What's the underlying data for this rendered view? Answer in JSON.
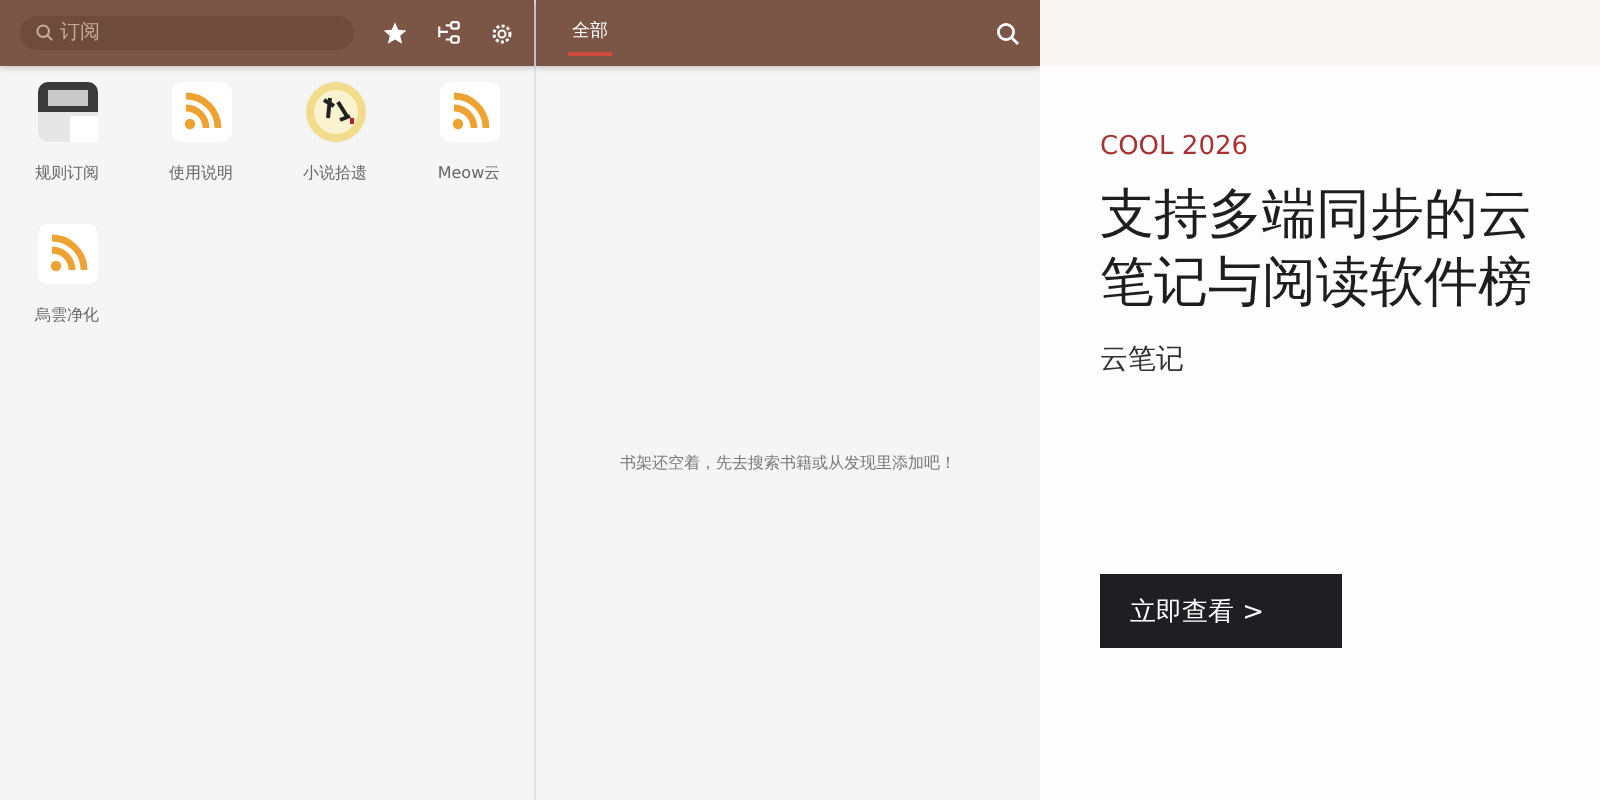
{
  "subscriptions": {
    "search": {
      "placeholder": "订阅"
    },
    "items": [
      {
        "label": "规则订阅",
        "kind": "reader"
      },
      {
        "label": "使用说明",
        "kind": "rss"
      },
      {
        "label": "小说拾遗",
        "kind": "seal"
      },
      {
        "label": "Meow云",
        "kind": "rss"
      },
      {
        "label": "烏雲净化",
        "kind": "rss"
      }
    ]
  },
  "bookshelf": {
    "tabs": [
      {
        "label": "全部",
        "selected": true
      }
    ],
    "empty_message": "书架还空着，先去搜索书籍或从发现里添加吧！"
  },
  "ad": {
    "brand": "COOL 2026",
    "headline": [
      "支持多端同步的云",
      "笔记与阅读软件榜"
    ],
    "subtitle": "云笔记",
    "button": "立即查看 >"
  }
}
